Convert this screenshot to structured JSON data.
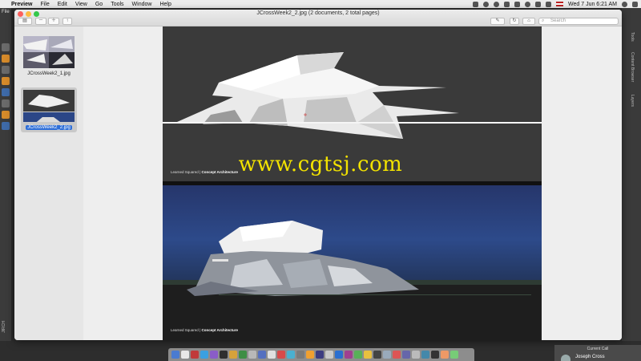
{
  "menubar": {
    "app_name": "Preview",
    "items": [
      "File",
      "Edit",
      "View",
      "Go",
      "Tools",
      "Window",
      "Help"
    ],
    "clock": "Wed 7 Jun  6:21 AM"
  },
  "host": {
    "file_label": "File",
    "left_label": "JIRCH",
    "right_tabs": [
      "Tools",
      "Content Browser",
      "Layers"
    ]
  },
  "window": {
    "title": "JCrossWeek2_2.jpg (2 documents, 2 total pages)",
    "search_placeholder": "Search"
  },
  "thumbnails": [
    {
      "label": "JCrossWeek2_1.jpg",
      "selected": false
    },
    {
      "label": "JCrossWeek2_2.jpg",
      "selected": true
    }
  ],
  "slides": {
    "caption_brand": "Learned Squared",
    "caption_course": "Concept Architecture"
  },
  "watermark": "www.cgtsj.com",
  "call": {
    "header": "Current Call",
    "name": "Joseph Cross"
  },
  "dock_colors": [
    "#4a7bd1",
    "#e8e8e8",
    "#c03a3a",
    "#3ba0e0",
    "#8a5cc8",
    "#2f2f2f",
    "#d6a23a",
    "#3e8e45",
    "#b8b8b8",
    "#5570c0",
    "#e0e0e0",
    "#d84a4a",
    "#4ab0d0",
    "#7a7a7a",
    "#f0a030",
    "#3c3c80",
    "#c8c8c8",
    "#2a6fd0",
    "#a04090",
    "#58b058",
    "#e8c040",
    "#444",
    "#9ab",
    "#d55",
    "#66a",
    "#bbb",
    "#48a",
    "#333",
    "#e96",
    "#7c7"
  ]
}
